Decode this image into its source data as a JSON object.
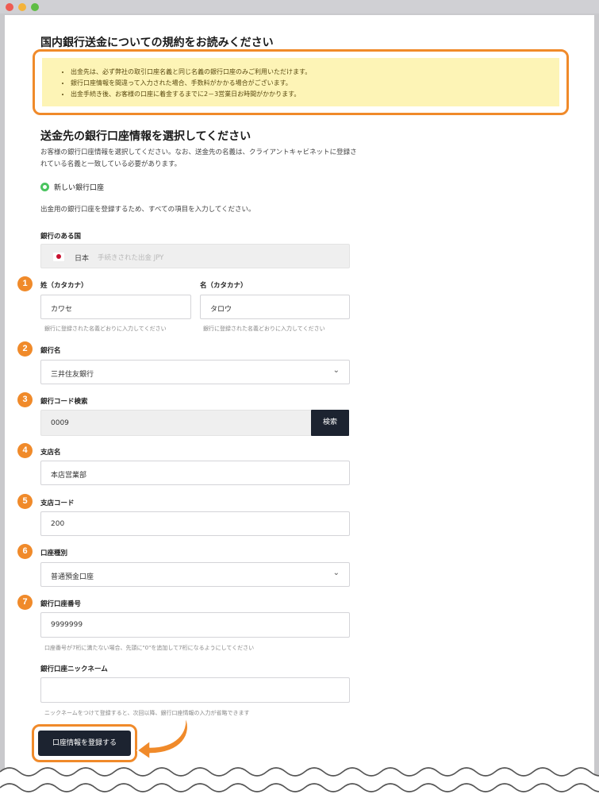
{
  "notice": {
    "title": "国内銀行送金についての規約をお読みください",
    "items": [
      "出金先は、必ず弊社の取引口座名義と同じ名義の銀行口座のみご利用いただけます。",
      "銀行口座情報を間違って入力された場合、手数料がかかる場合がございます。",
      "出金手続き後、お客様の口座に着金するまでに2－3営業日お時間がかかります。"
    ]
  },
  "select_section": {
    "title": "送金先の銀行口座情報を選択してください",
    "description_line1": "お客様の銀行口座情報を選択してください。なお、送金先の名義は、クライアントキャビネットに登録さ",
    "description_line2": "れている名義と一致している必要があります。",
    "radio_label": "新しい銀行口座",
    "instruction": "出金用の銀行口座を登録するため、すべての項目を入力してください。"
  },
  "form": {
    "country": {
      "label": "銀行のある国",
      "value": "日本",
      "sub": "手続きされた出金 JPY"
    },
    "last_name": {
      "badge": "1",
      "label": "姓（カタカナ）",
      "value": "カワセ",
      "hint": "銀行に登録された名義どおりに入力してください"
    },
    "first_name": {
      "label": "名（カタカナ）",
      "value": "タロウ",
      "hint": "銀行に登録された名義どおりに入力してください"
    },
    "bank_name": {
      "badge": "2",
      "label": "銀行名",
      "value": "三井住友銀行"
    },
    "bank_code": {
      "badge": "3",
      "label": "銀行コード検索",
      "value": "0009",
      "button": "検索"
    },
    "branch_name": {
      "badge": "4",
      "label": "支店名",
      "value": "本店営業部"
    },
    "branch_code": {
      "badge": "5",
      "label": "支店コード",
      "value": "200"
    },
    "account_type": {
      "badge": "6",
      "label": "口座種別",
      "value": "普通預金口座"
    },
    "account_number": {
      "badge": "7",
      "label": "銀行口座番号",
      "value": "9999999",
      "hint": "口座番号が7桁に満たない場合、先頭に\"0\"を追加して7桁になるようにしてください"
    },
    "nickname": {
      "label": "銀行口座ニックネーム",
      "value": "",
      "hint": "ニックネームをつけて登録すると、次回以降、銀行口座情報の入力が省略できます"
    },
    "submit": "口座情報を登録する"
  },
  "colors": {
    "accent": "#f08a2a",
    "notice_bg": "#fdf4b6",
    "button_dark": "#1c2330",
    "radio_green": "#4ac45f"
  }
}
